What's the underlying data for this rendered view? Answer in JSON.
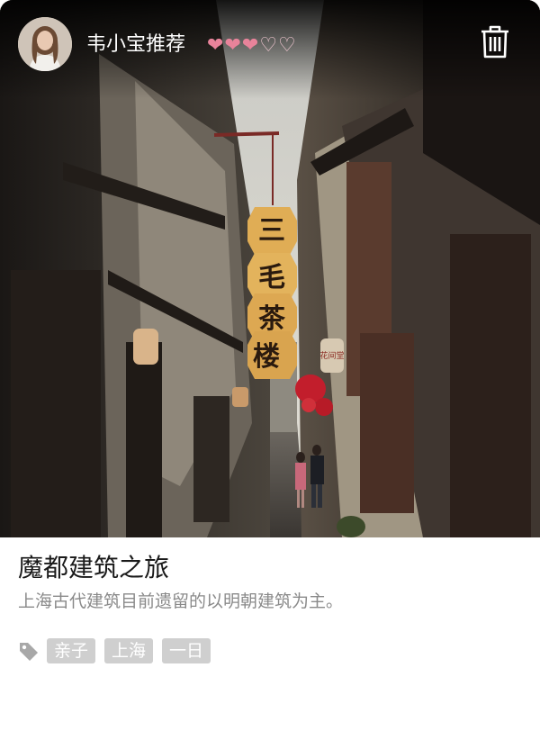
{
  "card": {
    "author_name": "韦小宝推荐",
    "rating": {
      "filled": 3,
      "total": 5
    },
    "icons": {
      "avatar": "avatar-photo",
      "delete": "trash-icon",
      "tag": "tag-icon"
    },
    "hero_image": {
      "sign_chars": [
        "三",
        "毛",
        "茶",
        "楼"
      ],
      "lantern_text": "花间堂"
    },
    "title": "魔都建筑之旅",
    "description": "上海古代建筑目前遗留的以明朝建筑为主。",
    "tags": [
      {
        "label": "亲子"
      },
      {
        "label": "上海"
      },
      {
        "label": "一日"
      }
    ],
    "colors": {
      "heart_full": "#e8839a",
      "heart_empty": "#f5cad4",
      "tag_bg": "#cfcfcf",
      "title": "#1a1a1a",
      "subtitle": "#8a8a8a"
    }
  }
}
